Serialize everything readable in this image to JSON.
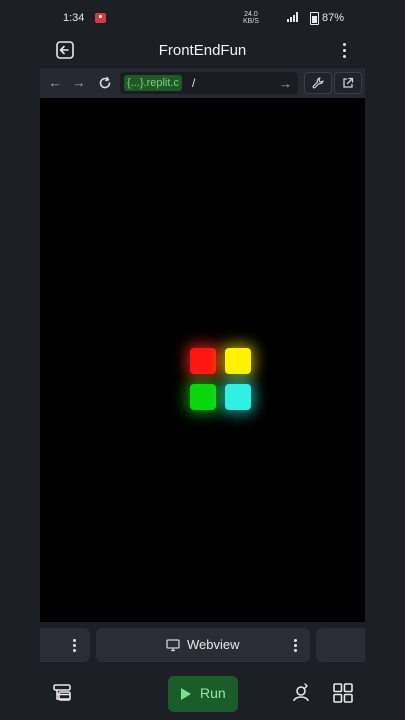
{
  "status": {
    "time": "1:34",
    "network_speed_value": "24.0",
    "network_speed_unit": "KB/S",
    "battery": "87%"
  },
  "app": {
    "title": "FrontEndFun"
  },
  "url": {
    "host_display": "{...}.replit.c",
    "path": "/"
  },
  "tabs": {
    "active_label": "Webview"
  },
  "bottom": {
    "run_label": "Run"
  },
  "colors": {
    "red": "#ff1414",
    "yellow": "#fff200",
    "green": "#0bd60b",
    "cyan": "#2ff0e2",
    "run_bg": "#1a5d2a"
  },
  "icons": [
    "exit-icon",
    "kebab-menu-icon",
    "back-arrow-icon",
    "forward-arrow-icon",
    "reload-icon",
    "wrench-icon",
    "external-link-icon",
    "monitor-icon",
    "layers-icon",
    "grid-icon",
    "user-swap-icon"
  ]
}
